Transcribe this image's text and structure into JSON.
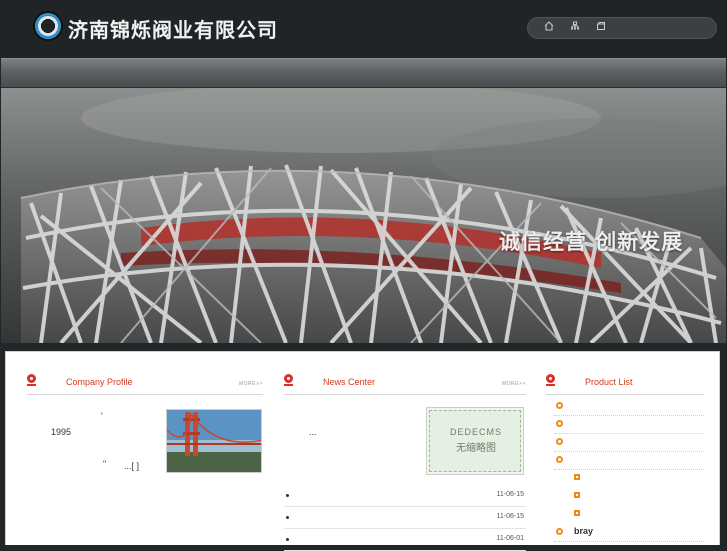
{
  "header": {
    "company_name": "济南锦烁阀业有限公司",
    "toolbar_icons": [
      "home-icon",
      "sitemap-icon",
      "bookmark-icon"
    ]
  },
  "banner": {
    "slogan": "诚信经营 创新发展"
  },
  "company_profile": {
    "title": "Company Profile",
    "more": "MORE>>",
    "comma": "'",
    "year": "1995",
    "quote": "\"",
    "read_more": "...[   ]"
  },
  "news_center": {
    "title": "News Center",
    "more": "MORE>>",
    "excerpt": "...",
    "thumb_line1": "DEDECMS",
    "thumb_line2": "无缩略图",
    "items": [
      {
        "date": "11-06-15"
      },
      {
        "date": "11-06-15"
      },
      {
        "date": "11-06-01"
      }
    ]
  },
  "product_list": {
    "title": "Product List",
    "items": [
      {
        "label": "",
        "level": 1
      },
      {
        "label": "",
        "level": 1
      },
      {
        "label": "",
        "level": 1
      },
      {
        "label": "",
        "level": 1
      },
      {
        "label": "",
        "level": 2
      },
      {
        "label": "",
        "level": 2
      },
      {
        "label": "",
        "level": 2
      },
      {
        "label": "bray",
        "level": 1
      }
    ]
  },
  "colors": {
    "accent_red": "#d43b1e",
    "icon_orange": "#ef8a16",
    "header_bg": "#202426"
  }
}
